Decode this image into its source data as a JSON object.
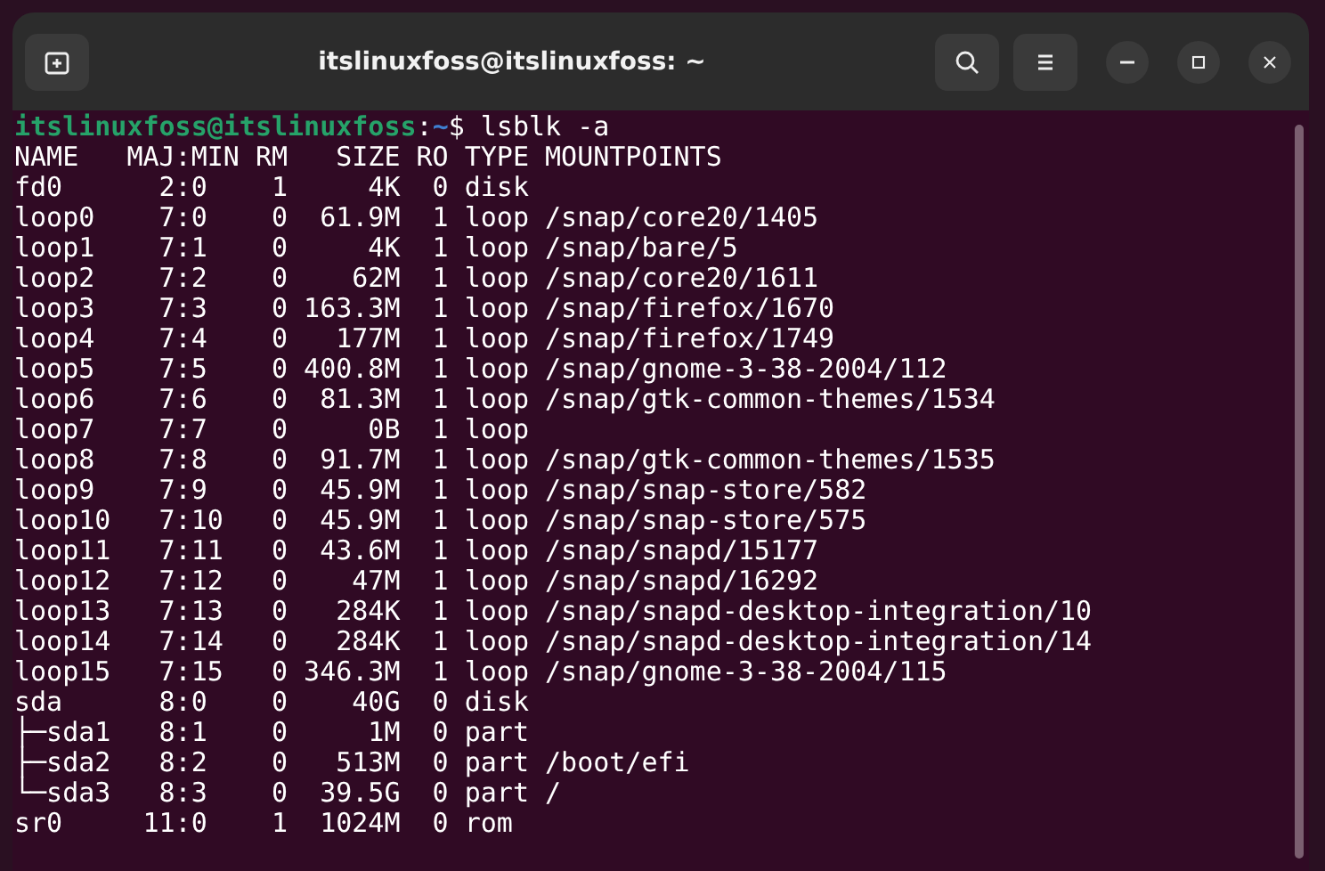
{
  "window": {
    "title": "itslinuxfoss@itslinuxfoss: ~"
  },
  "prompt": {
    "user_host": "itslinuxfoss@itslinuxfoss",
    "separator": ":",
    "path": "~",
    "symbol": "$",
    "command": "lsblk -a"
  },
  "output_lines": [
    "NAME   MAJ:MIN RM   SIZE RO TYPE MOUNTPOINTS",
    "fd0      2:0    1     4K  0 disk ",
    "loop0    7:0    0  61.9M  1 loop /snap/core20/1405",
    "loop1    7:1    0     4K  1 loop /snap/bare/5",
    "loop2    7:2    0    62M  1 loop /snap/core20/1611",
    "loop3    7:3    0 163.3M  1 loop /snap/firefox/1670",
    "loop4    7:4    0   177M  1 loop /snap/firefox/1749",
    "loop5    7:5    0 400.8M  1 loop /snap/gnome-3-38-2004/112",
    "loop6    7:6    0  81.3M  1 loop /snap/gtk-common-themes/1534",
    "loop7    7:7    0     0B  1 loop ",
    "loop8    7:8    0  91.7M  1 loop /snap/gtk-common-themes/1535",
    "loop9    7:9    0  45.9M  1 loop /snap/snap-store/582",
    "loop10   7:10   0  45.9M  1 loop /snap/snap-store/575",
    "loop11   7:11   0  43.6M  1 loop /snap/snapd/15177",
    "loop12   7:12   0    47M  1 loop /snap/snapd/16292",
    "loop13   7:13   0   284K  1 loop /snap/snapd-desktop-integration/10",
    "loop14   7:14   0   284K  1 loop /snap/snapd-desktop-integration/14",
    "loop15   7:15   0 346.3M  1 loop /snap/gnome-3-38-2004/115",
    "sda      8:0    0    40G  0 disk ",
    "├─sda1   8:1    0     1M  0 part ",
    "├─sda2   8:2    0   513M  0 part /boot/efi",
    "└─sda3   8:3    0  39.5G  0 part /",
    "sr0     11:0    1  1024M  0 rom  "
  ]
}
